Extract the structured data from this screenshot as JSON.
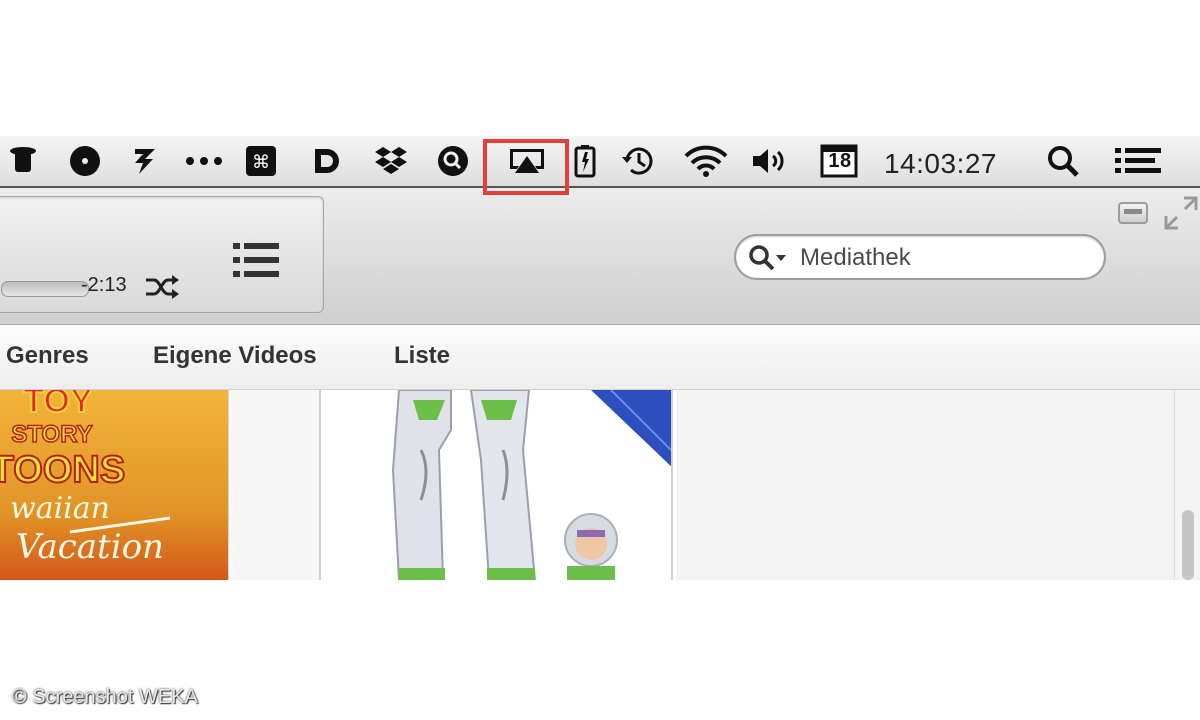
{
  "menubar": {
    "icons": [
      "top-hat-icon",
      "disc-icon",
      "lightning-icon",
      "overflow-dots-icon",
      "command-key-icon",
      "d-app-icon",
      "dropbox-icon",
      "magnifier-app-icon",
      "airplay-icon",
      "battery-icon",
      "time-machine-icon",
      "wifi-icon",
      "volume-icon",
      "calendar-icon",
      "spotlight-icon",
      "notification-list-icon"
    ],
    "calendar_day": "18",
    "clock": "14:03:27",
    "highlighted_item": "airplay-icon",
    "highlight_color": "#e2403b"
  },
  "player": {
    "remaining_time": "-2:13"
  },
  "search": {
    "placeholder": "Mediathek"
  },
  "nav": {
    "items": [
      "Genres",
      "Eigene Videos",
      "Liste"
    ]
  },
  "posters": {
    "left": {
      "title_line1": "TOY",
      "title_line2": "STORY",
      "title_line3": "TOONS",
      "subtitle_line1": "waiian",
      "subtitle_line2": "Vacation"
    }
  },
  "watermark": "© Screenshot WEKA"
}
